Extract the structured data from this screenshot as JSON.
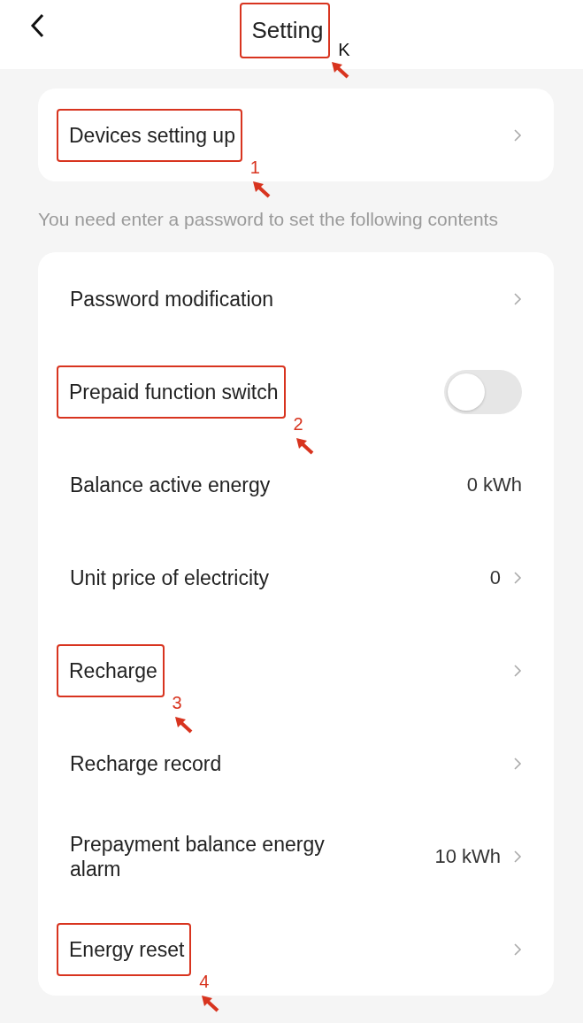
{
  "header": {
    "title": "Setting",
    "annotation": "K"
  },
  "device_card": {
    "label": "Devices setting up",
    "annotation": "1"
  },
  "hint": "You need enter a password to set the following contents",
  "rows": [
    {
      "kind": "link",
      "label": "Password modification"
    },
    {
      "kind": "toggle",
      "label": "Prepaid function switch",
      "on": false,
      "annotation": "2"
    },
    {
      "kind": "value",
      "label": "Balance active energy",
      "value": "0 kWh"
    },
    {
      "kind": "link",
      "label": "Unit price of electricity",
      "value": "0"
    },
    {
      "kind": "link",
      "label": "Recharge",
      "annotation": "3"
    },
    {
      "kind": "link",
      "label": "Recharge record"
    },
    {
      "kind": "link",
      "label": "Prepayment balance energy alarm",
      "value": "10 kWh"
    },
    {
      "kind": "link",
      "label": "Energy reset",
      "annotation": "4"
    }
  ]
}
